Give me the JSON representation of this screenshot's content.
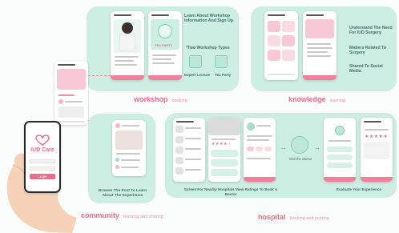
{
  "colors": {
    "panel": "#cdeee3",
    "accent_pink": "#f06b8a",
    "text_teal": "#3f6e66"
  },
  "workshop": {
    "title": "workshop",
    "subtitle": "booking",
    "caption_1": "Learn About Workshop Information And Sign Up",
    "caption_2": "*Two Workshop Types",
    "type_1": "Expert Lecture",
    "type_2": "Tea Party",
    "phone_label": "TEA PARTY"
  },
  "knowledge": {
    "title": "knowledge",
    "subtitle": "learning",
    "points": [
      "Understand The Need For IUD Surgery",
      "Matters Related To Surgery",
      "Shared To Social Media"
    ]
  },
  "community": {
    "title": "community",
    "subtitle": "learning and sharing",
    "caption": "Browse The Post To Learn About The Experience"
  },
  "hospital": {
    "title": "hospital",
    "subtitle": "booking and scoring",
    "caption_1": "Screen For Nearby Hospitals View Ratings To Book A Doctor",
    "caption_2": "Visit the doctor",
    "caption_3": "Evaluate Your Experience"
  },
  "login_phone": {
    "app_name": "IUD Care",
    "login_label": "Login"
  }
}
